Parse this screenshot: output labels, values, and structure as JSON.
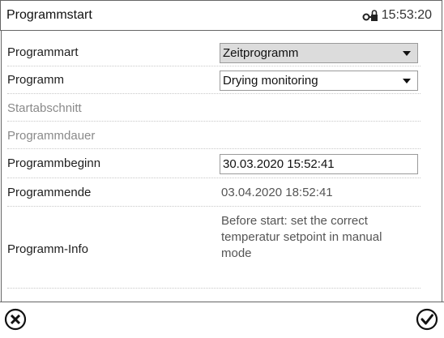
{
  "header": {
    "title": "Programmstart",
    "time": "15:53:20",
    "lock_icon": "lock-key-icon"
  },
  "form": {
    "programmart": {
      "label": "Programmart",
      "value": "Zeitprogramm"
    },
    "programm": {
      "label": "Programm",
      "value": "Drying monitoring"
    },
    "startabschnitt": {
      "label": "Startabschnitt"
    },
    "programmdauer": {
      "label": "Programmdauer"
    },
    "programmbeginn": {
      "label": "Programmbeginn",
      "value": "30.03.2020 15:52:41"
    },
    "programmende": {
      "label": "Programmende",
      "value": "03.04.2020 18:52:41"
    },
    "programm_info": {
      "label": "Programm-Info",
      "value": "Before start: set the correct temperatur setpoint in manual mode"
    }
  },
  "footer": {
    "cancel_icon": "cancel-circle-icon",
    "confirm_icon": "confirm-check-icon"
  }
}
